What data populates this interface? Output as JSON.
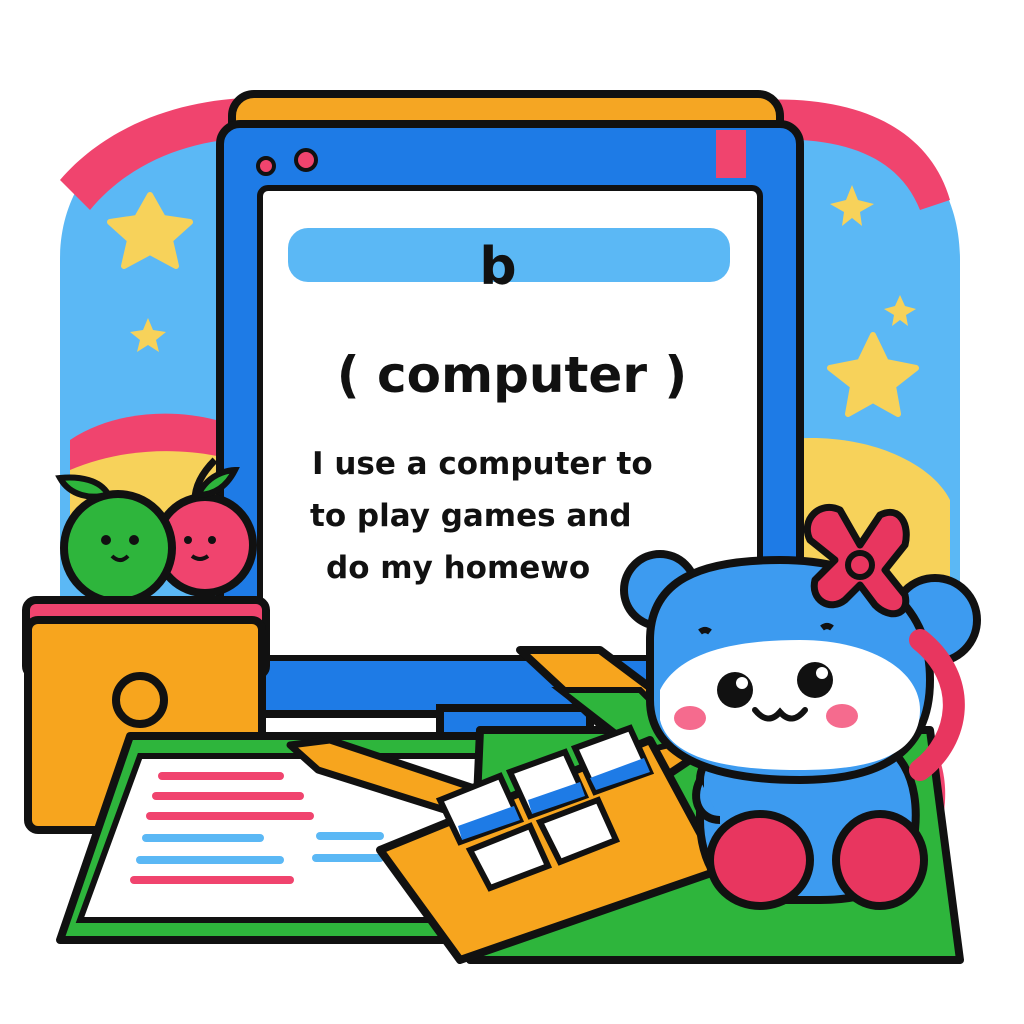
{
  "screen": {
    "letter": "b",
    "title": "( computer )",
    "sentence_line_1": "I use a computer to",
    "sentence_line_2": "to play games and",
    "sentence_line_3": "do my homewo"
  },
  "colors": {
    "outline": "#111111",
    "monitor_blue": "#1E7BE6",
    "monitor_orange": "#F5A623",
    "search_bar": "#5BB8F5",
    "sky_blue": "#5BB8F5",
    "sky_pink": "#F0446E",
    "sky_yellow": "#F7D25A",
    "book_green": "#2EB53C",
    "calc_orange": "#F7A51E",
    "bear_blue": "#3D9BF0",
    "bear_pink": "#E8365F"
  },
  "icons": [
    "star-icon",
    "window-dot-icon",
    "apple-icon",
    "pencil-icon",
    "book-icon",
    "calculator-icon",
    "bear-mascot-icon"
  ]
}
